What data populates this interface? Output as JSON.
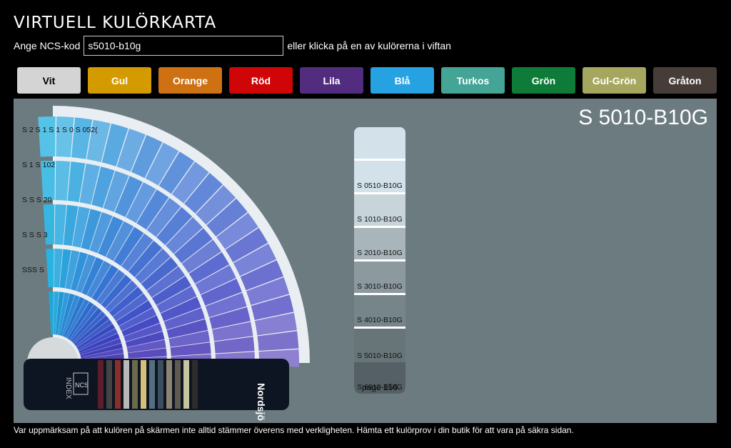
{
  "header": {
    "title": "VIRTUELL KULÖRKARTA",
    "code_label": "Ange NCS-kod",
    "code_value": "s5010-b10g",
    "code_hint": "eller klicka på en av kulörerna i viftan"
  },
  "tabs": [
    {
      "label": "Vit",
      "color": "#d4d4d4",
      "light": true
    },
    {
      "label": "Gul",
      "color": "#d39b00"
    },
    {
      "label": "Orange",
      "color": "#cd7113"
    },
    {
      "label": "Röd",
      "color": "#cf0508"
    },
    {
      "label": "Lila",
      "color": "#522c7f"
    },
    {
      "label": "Blå",
      "color": "#26a1e1"
    },
    {
      "label": "Turkos",
      "color": "#44a596"
    },
    {
      "label": "Grön",
      "color": "#0e7c38"
    },
    {
      "label": "Gul-Grön",
      "color": "#a6a75e"
    },
    {
      "label": "Gråton",
      "color": "#463d39"
    }
  ],
  "main": {
    "selected_code": "S 5010-B10G",
    "panel_color": "#6c7b80",
    "fan_brand": "Nordsjö",
    "fan_index_label": "INDEX",
    "fan_logo": "NCS",
    "fan_row_labels": [
      "S 2  S 1  S 1  S 0  S 052(",
      "S 1  S 102",
      "S  S  S 20",
      "S S S 3",
      "SSS S"
    ],
    "strip": {
      "swatches": [
        {
          "code": "",
          "color": "#d3e2ea"
        },
        {
          "code": "S 0510-B10G",
          "color": "#d3e2ea"
        },
        {
          "code": "S 1010-B10G",
          "color": "#c7d4da"
        },
        {
          "code": "S 2010-B10G",
          "color": "#a8b6bb"
        },
        {
          "code": "S 3010-B10G",
          "color": "#8c9a9f"
        },
        {
          "code": "S 4010-B10G",
          "color": "#76858a"
        },
        {
          "code": "S 5010-B10G",
          "color": "#677579"
        },
        {
          "code": "S 6010-B10G",
          "color": "#546065"
        }
      ],
      "page": "page 156"
    }
  },
  "footer": {
    "note": "Var uppmärksam på att kulören på skärmen inte alltid stämmer överens med verkligheten. Hämta ett kulörprov i din butik för att vara på säkra sidan."
  }
}
